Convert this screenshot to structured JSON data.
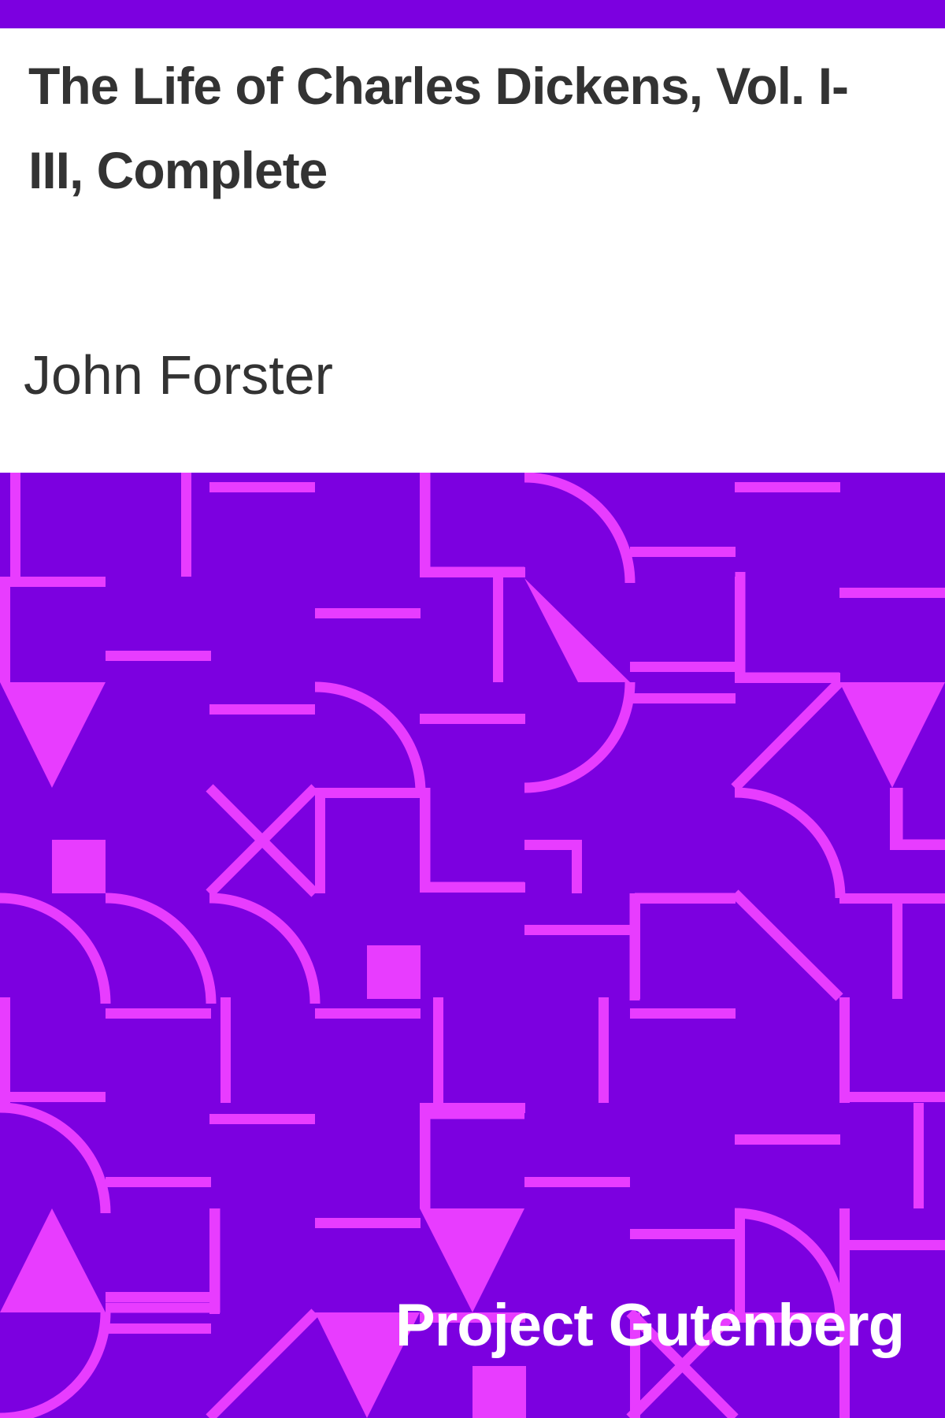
{
  "cover": {
    "title": "The Life of Charles Dickens, Vol. I-III, Complete",
    "author": "John Forster",
    "publisher": "Project Gutenberg"
  },
  "colors": {
    "background": "#7c00e0",
    "pattern": "#e83cff",
    "title_panel": "#ffffff",
    "text_dark": "#333333",
    "text_light": "#ffffff"
  }
}
